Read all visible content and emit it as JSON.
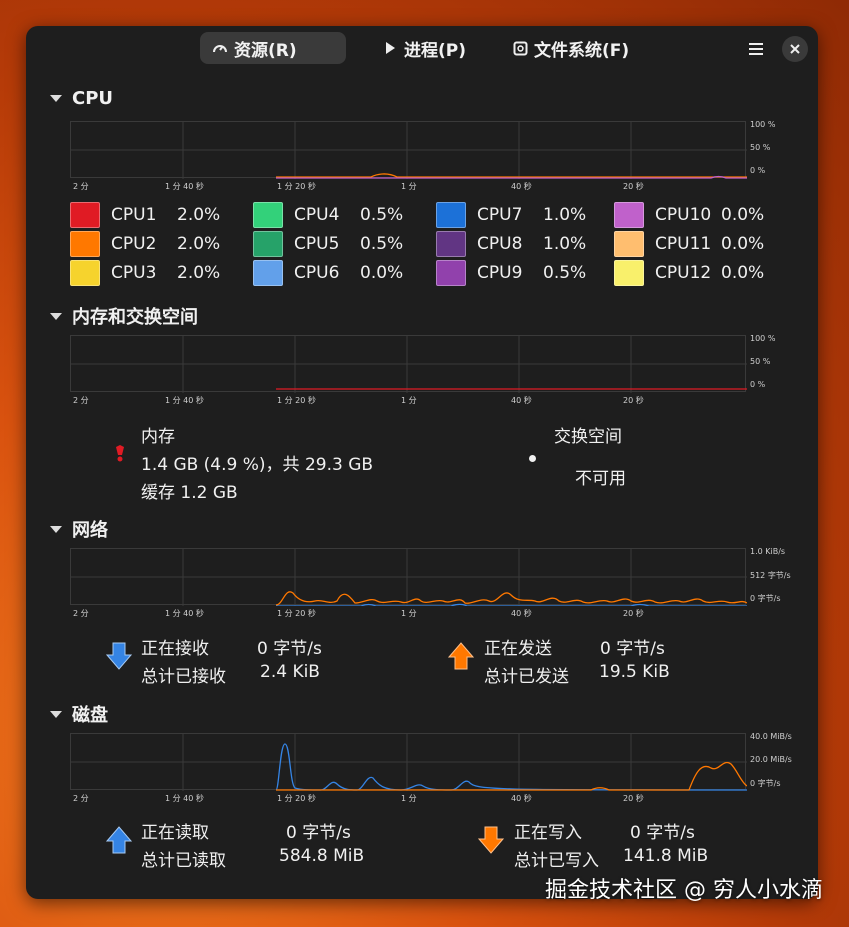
{
  "tabs": [
    {
      "label": "资源(R)",
      "icon": "gauge-icon",
      "active": true
    },
    {
      "label": "进程(P)",
      "icon": "play-icon",
      "active": false
    },
    {
      "label": "文件系统(F)",
      "icon": "disk-icon",
      "active": false
    }
  ],
  "time_axis": [
    "2 分",
    "1 分 40 秒",
    "1 分 20 秒",
    "1 分",
    "40 秒",
    "20 秒"
  ],
  "cpu": {
    "title": "CPU",
    "y_ticks": [
      "100 %",
      "50 %",
      "0 %"
    ],
    "items": [
      {
        "name": "CPU1",
        "value": "2.0%",
        "color": "#e01b24"
      },
      {
        "name": "CPU2",
        "value": "2.0%",
        "color": "#ff7800"
      },
      {
        "name": "CPU3",
        "value": "2.0%",
        "color": "#f6d32d"
      },
      {
        "name": "CPU4",
        "value": "0.5%",
        "color": "#33d17a"
      },
      {
        "name": "CPU5",
        "value": "0.5%",
        "color": "#26a269"
      },
      {
        "name": "CPU6",
        "value": "0.0%",
        "color": "#62a0ea"
      },
      {
        "name": "CPU7",
        "value": "1.0%",
        "color": "#1c71d8"
      },
      {
        "name": "CPU8",
        "value": "1.0%",
        "color": "#613583"
      },
      {
        "name": "CPU9",
        "value": "0.5%",
        "color": "#9141ac"
      },
      {
        "name": "CPU10",
        "value": "0.0%",
        "color": "#c061cb"
      },
      {
        "name": "CPU11",
        "value": "0.0%",
        "color": "#ffbe6f"
      },
      {
        "name": "CPU12",
        "value": "0.0%",
        "color": "#f9f06b"
      }
    ]
  },
  "memory": {
    "title": "内存和交换空间",
    "y_ticks": [
      "100 %",
      "50 %",
      "0 %"
    ],
    "mem_label": "内存",
    "mem_usage": "1.4 GB (4.9 %)，共 29.3 GB",
    "mem_cache": "缓存 1.2 GB",
    "swap_label": "交换空间",
    "swap_value": "不可用",
    "mem_color": "#e01b24"
  },
  "network": {
    "title": "网络",
    "y_ticks": [
      "1.0 KiB/s",
      "512 字节/s",
      "0 字节/s"
    ],
    "recv_label": "正在接收",
    "recv_value": "0 字节/s",
    "recv_total_label": "总计已接收",
    "recv_total_value": "2.4 KiB",
    "send_label": "正在发送",
    "send_value": "0 字节/s",
    "send_total_label": "总计已发送",
    "send_total_value": "19.5 KiB",
    "recv_color": "#3584e4",
    "send_color": "#f66151"
  },
  "disk": {
    "title": "磁盘",
    "y_ticks": [
      "40.0 MiB/s",
      "20.0 MiB/s",
      "0 字节/s"
    ],
    "read_label": "正在读取",
    "read_value": "0 字节/s",
    "read_total_label": "总计已读取",
    "read_total_value": "584.8 MiB",
    "write_label": "正在写入",
    "write_value": "0 字节/s",
    "write_total_label": "总计已写入",
    "write_total_value": "141.8 MiB"
  },
  "watermark": "掘金技术社区 @ 穷人小水滴"
}
